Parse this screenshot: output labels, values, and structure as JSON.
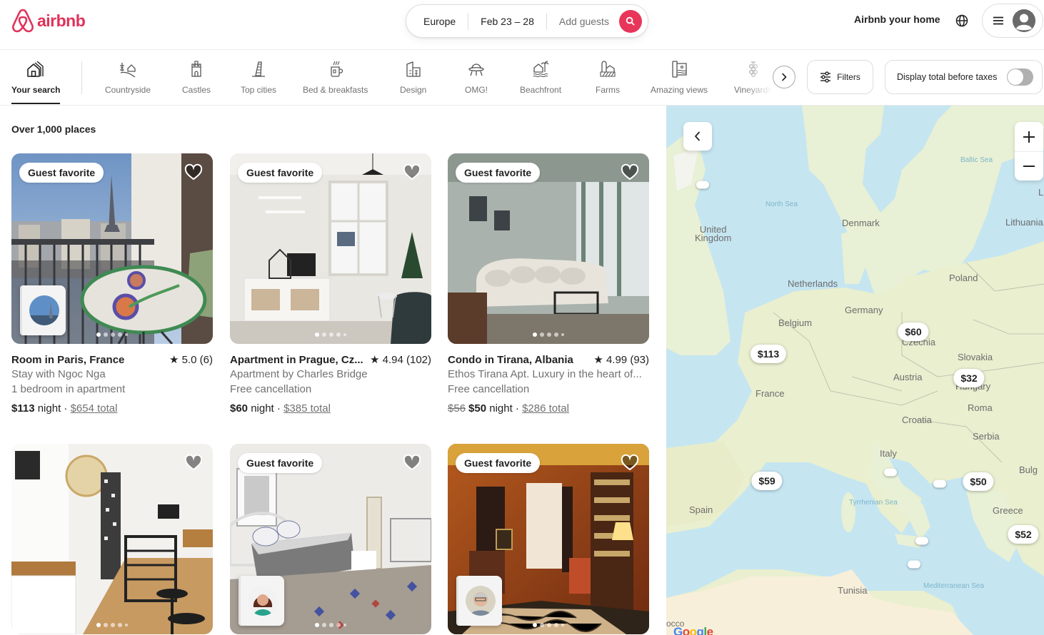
{
  "header": {
    "logo_text": "airbnb",
    "brand_color": "#e0325a",
    "search": {
      "place": "Europe",
      "dates": "Feb 23 – 28",
      "guests_placeholder": "Add guests"
    },
    "host_link": "Airbnb your home"
  },
  "categories": [
    {
      "label": "Your search",
      "icon": "your-search-icon",
      "active": true
    },
    {
      "label": "Countryside",
      "icon": "countryside-icon"
    },
    {
      "label": "Castles",
      "icon": "castle-icon"
    },
    {
      "label": "Top cities",
      "icon": "top-cities-icon"
    },
    {
      "label": "Bed & breakfasts",
      "icon": "bed-breakfast-icon"
    },
    {
      "label": "Design",
      "icon": "design-icon"
    },
    {
      "label": "OMG!",
      "icon": "ufo-icon"
    },
    {
      "label": "Beachfront",
      "icon": "beachfront-icon"
    },
    {
      "label": "Farms",
      "icon": "farm-icon"
    },
    {
      "label": "Amazing views",
      "icon": "amazing-views-icon"
    },
    {
      "label": "Vineyards",
      "icon": "vineyard-icon"
    }
  ],
  "filters_label": "Filters",
  "taxes_label": "Display total before taxes",
  "taxes_toggle_on": false,
  "results_count": "Over 1,000 places",
  "listings": [
    {
      "badge": "Guest favorite",
      "title": "Room in Paris, France",
      "rating": "★ 5.0 (6)",
      "line1": "Stay with Ngoc Nga",
      "line2": "1 bedroom in apartment",
      "old_price": "",
      "price": "$113",
      "night": " night · ",
      "total": "$654 total"
    },
    {
      "badge": "Guest favorite",
      "title": "Apartment in Prague, Cz...",
      "rating": "★ 4.94 (102)",
      "line1": "Apartment by Charles Bridge",
      "line2": "Free cancellation",
      "old_price": "",
      "price": "$60",
      "night": " night · ",
      "total": "$385 total"
    },
    {
      "badge": "Guest favorite",
      "title": "Condo in Tirana, Albania",
      "rating": "★ 4.99 (93)",
      "line1": "Ethos Tirana Apt. Luxury in the heart of...",
      "line2": "Free cancellation",
      "old_price": "$56",
      "price": "$50",
      "night": " night · ",
      "total": "$286 total"
    },
    {
      "badge": ""
    },
    {
      "badge": "Guest favorite"
    },
    {
      "badge": "Guest favorite"
    }
  ],
  "map": {
    "labels": {
      "north_sea": "North Sea",
      "baltic_sea": "Baltic Sea",
      "uk": "United Kingdom",
      "denmark": "Denmark",
      "lithuania": "Lithuania",
      "latvia": "L",
      "netherlands": "Netherlands",
      "poland": "Poland",
      "belgium": "Belgium",
      "germany": "Germany",
      "czechia": "Czechia",
      "slovakia": "Slovakia",
      "france": "France",
      "austria": "Austria",
      "hungary": "Hungary",
      "romania": "Roma",
      "croatia": "Croatia",
      "serbia": "Serbia",
      "italy": "Italy",
      "bulgaria": "Bulg",
      "spain": "Spain",
      "tyrrhenian": "Tyrrhenian Sea",
      "greece": "Greece",
      "tunisia": "Tunisia",
      "mediterranean": "Mediterranean Sea",
      "morocco": "occo",
      "google": "Google"
    },
    "price_pins": [
      "$60",
      "$113",
      "$32",
      "$59",
      "$50",
      "$52"
    ]
  }
}
